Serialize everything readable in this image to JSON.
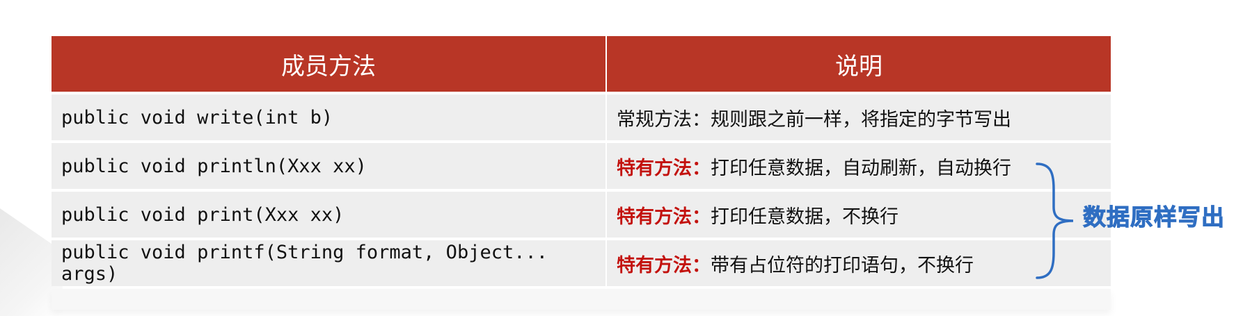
{
  "table": {
    "headers": [
      "成员方法",
      "说明"
    ],
    "rows": [
      {
        "method": "public void write(int b)",
        "label": "",
        "desc": "常规方法：规则跟之前一样，将指定的字节写出"
      },
      {
        "method": "public void println(Xxx xx)",
        "label": "特有方法：",
        "desc": "打印任意数据，自动刷新，自动换行"
      },
      {
        "method": "public void print(Xxx xx)",
        "label": "特有方法：",
        "desc": "打印任意数据，不换行"
      },
      {
        "method": "public void printf(String format, Object... args)",
        "label": "特有方法：",
        "desc": "带有占位符的打印语句，不换行"
      }
    ]
  },
  "annotation": {
    "text": "数据原样写出"
  },
  "colors": {
    "header_bg": "#B83626",
    "emphasis": "#C3120E",
    "annotation": "#2F6EC2",
    "row_bg": "#eeeeee"
  }
}
